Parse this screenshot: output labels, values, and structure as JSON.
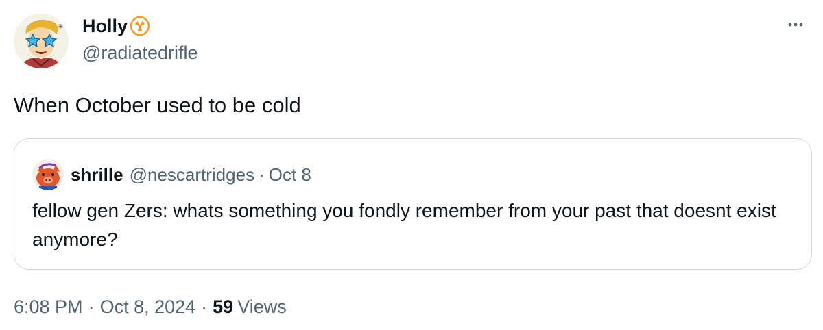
{
  "author": {
    "display_name": "Holly",
    "handle": "@radiatedrifle",
    "avatar_icon": "vault-boy-avatar-icon",
    "badge_icon": "radiation-badge-icon",
    "badge_color": "#f59a23"
  },
  "menu": {
    "icon": "more-options-icon"
  },
  "tweet": {
    "text": "When October used to be cold"
  },
  "quote": {
    "display_name": "shrille",
    "handle": "@nescartridges",
    "separator": "·",
    "date": "Oct 8",
    "text": "fellow gen Zers: whats something you fondly remember from your past that doesnt exist anymore?",
    "avatar_icon": "cartoon-pig-avatar-icon"
  },
  "meta": {
    "time": "6:08 PM",
    "date": "Oct 8, 2024",
    "separator": "·",
    "views_count": "59",
    "views_label": "Views"
  },
  "colors": {
    "text_primary": "#0f1419",
    "text_secondary": "#536471",
    "border": "#cfd9de"
  }
}
